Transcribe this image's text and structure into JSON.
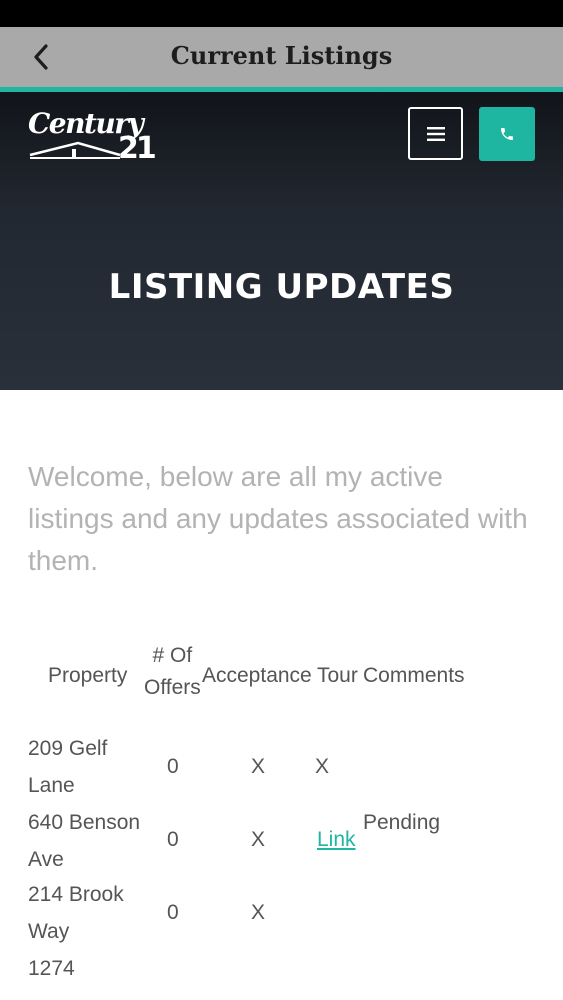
{
  "nav": {
    "title": "Current Listings",
    "back_icon": "chevron-left-icon"
  },
  "header": {
    "logo_word": "Century",
    "logo_number": "21",
    "menu_icon": "hamburger-menu-icon",
    "phone_icon": "phone-icon",
    "hero_title": "LISTING UPDATES",
    "accent_color": "#1fb6a1"
  },
  "intro": {
    "text": "Welcome, below are all my active listings and any updates associated with them."
  },
  "table": {
    "headers": {
      "property": "Property",
      "offers_line1": "# Of",
      "offers_line2": "Offers",
      "acceptance": "Acceptance",
      "tour": "Tour",
      "comments": "Comments"
    },
    "rows": [
      {
        "property_line1": "209 Gelf",
        "property_line2": "Lane",
        "offers": "0",
        "acceptance": "X",
        "tour": "X",
        "comments": ""
      },
      {
        "property_line1": "640 Benson",
        "property_line2": "Ave",
        "offers": "0",
        "acceptance": "X",
        "tour": "Link",
        "comments": "Pending"
      },
      {
        "property_line1": "214 Brook",
        "property_line2": "Way",
        "offers": "0",
        "acceptance": "X",
        "tour": "",
        "comments": ""
      },
      {
        "property_line1": "1274",
        "property_line2": "",
        "offers": "",
        "acceptance": "",
        "tour": "",
        "comments": ""
      }
    ]
  }
}
